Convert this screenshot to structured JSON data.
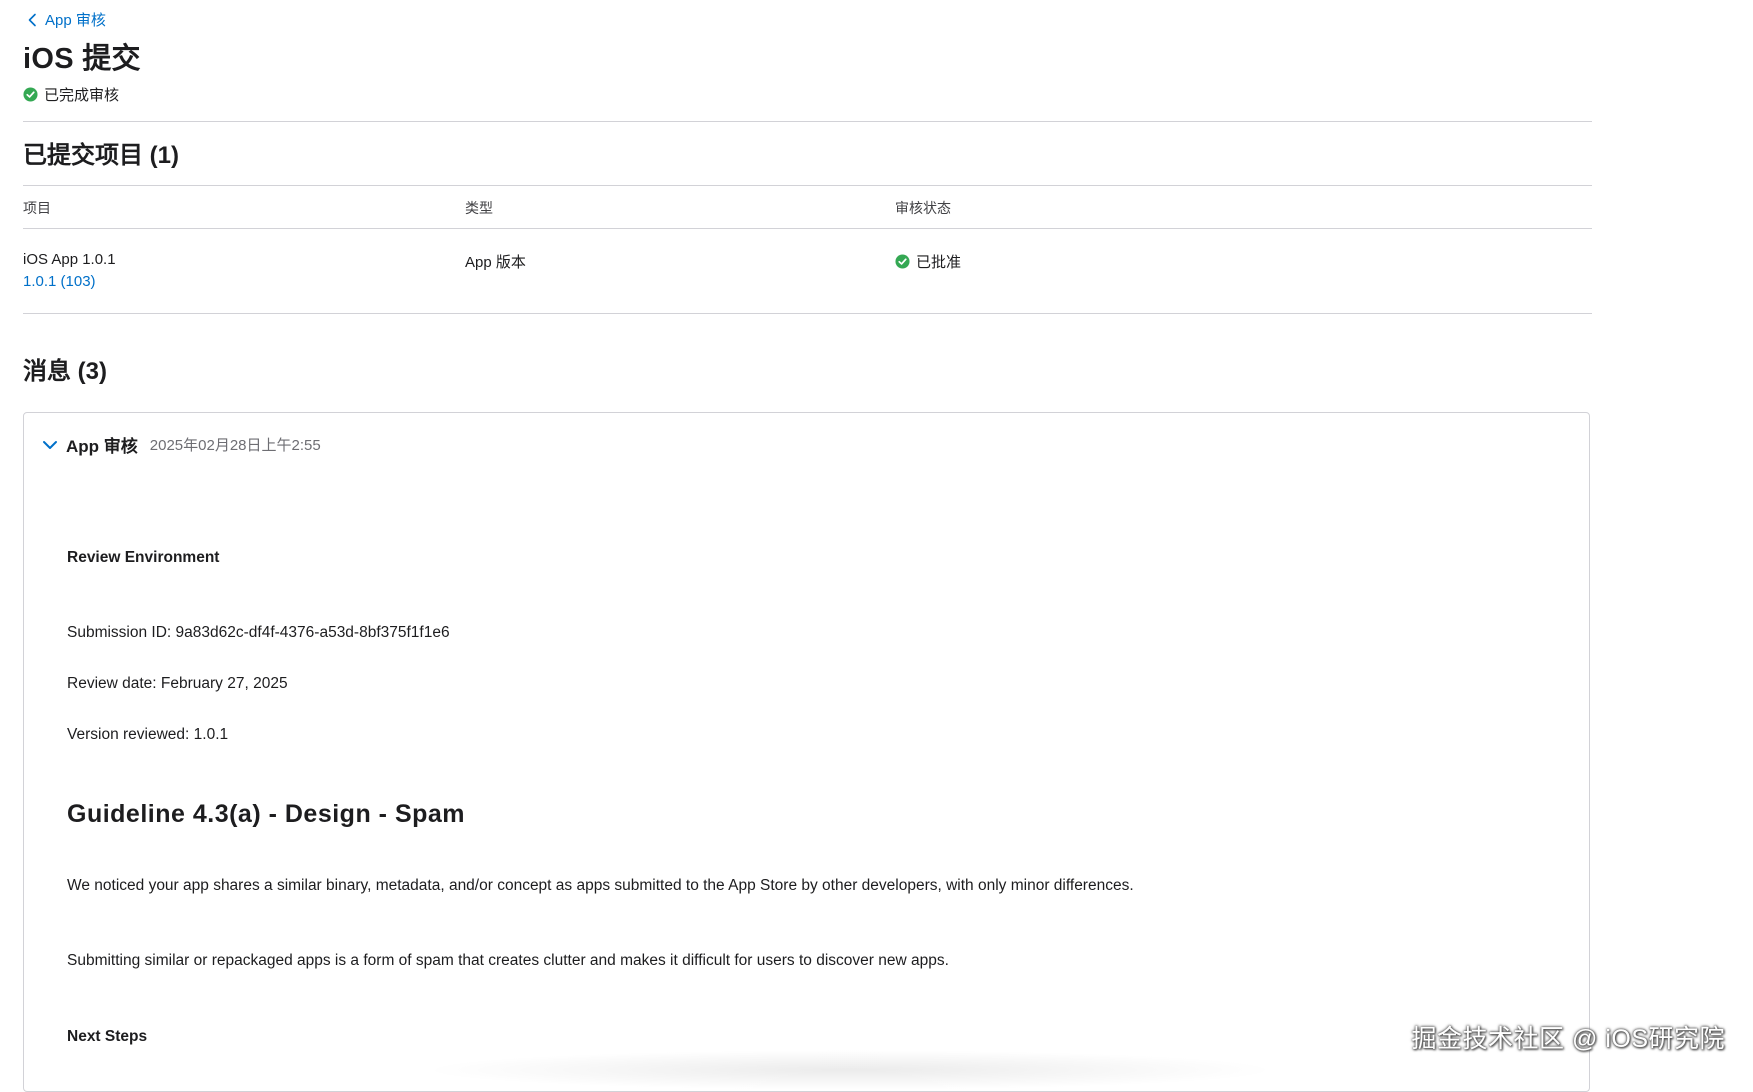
{
  "breadcrumb": {
    "label": "App 审核"
  },
  "page": {
    "title": "iOS 提交",
    "status": "已完成审核"
  },
  "submitted_items": {
    "title": "已提交项目 (1)",
    "columns": [
      "项目",
      "类型",
      "审核状态"
    ],
    "rows": [
      {
        "item_name": "iOS App 1.0.1",
        "item_build": "1.0.1 (103)",
        "type": "App 版本",
        "status": "已批准"
      }
    ]
  },
  "messages": {
    "title": "消息 (3)",
    "items": [
      {
        "sender": "App 审核",
        "date": "2025年02月28日上午2:55",
        "body": {
          "review_env_heading": "Review Environment",
          "submission_id": "Submission ID: 9a83d62c-df4f-4376-a53d-8bf375f1f1e6",
          "review_date": "Review date: February 27, 2025",
          "version_reviewed": "Version reviewed: 1.0.1",
          "guideline_heading": "Guideline 4.3(a) - Design - Spam",
          "para1": "We noticed your app shares a similar binary, metadata, and/or concept as apps submitted to the App Store by other developers, with only minor differences.",
          "para2": "Submitting similar or repackaged apps is a form of spam that creates clutter and makes it difficult for users to discover new apps.",
          "next_steps_heading": "Next Steps"
        }
      }
    ]
  },
  "watermark": "掘金技术社区 @ iOS研究院",
  "colors": {
    "link": "#0070c9",
    "success": "#34a853",
    "divider": "#d2d2d7",
    "text": "#1d1d1f",
    "muted": "#6e6e73"
  },
  "icons": {
    "back": "chevron-left-icon",
    "status": "check-circle-icon",
    "expand": "chevron-down-icon"
  }
}
